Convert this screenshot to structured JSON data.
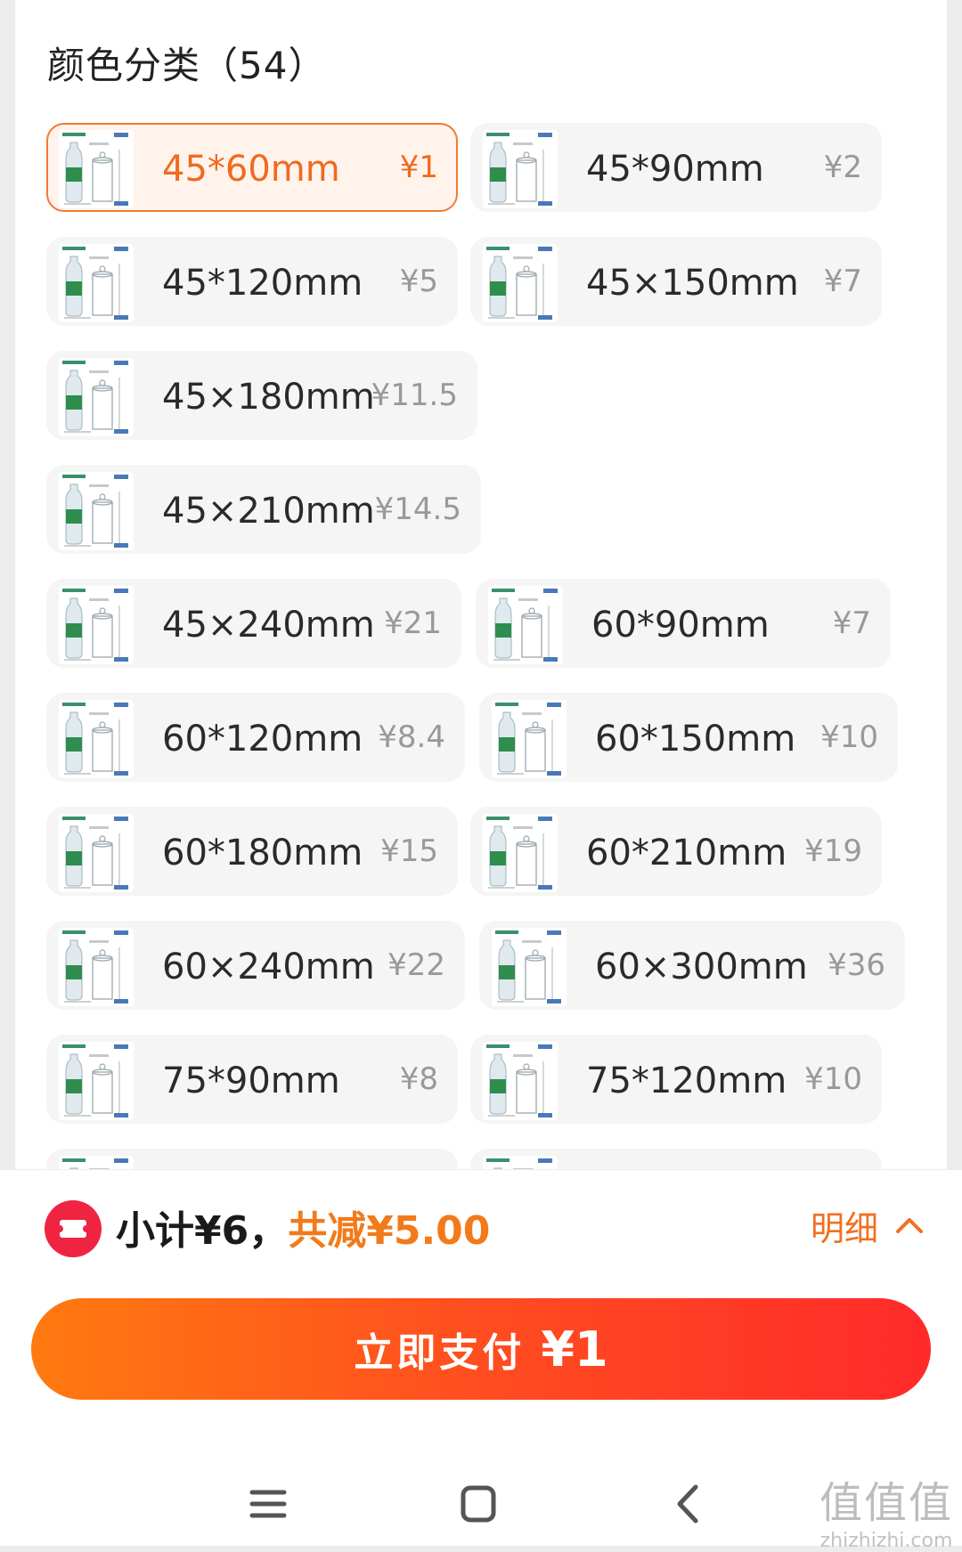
{
  "section": {
    "title": "颜色分类（54）"
  },
  "options": [
    {
      "name": "45*60mm",
      "price": "¥1",
      "selected": true
    },
    {
      "name": "45*90mm",
      "price": "¥2",
      "selected": false
    },
    {
      "name": "45*120mm",
      "price": "¥5",
      "selected": false
    },
    {
      "name": "45×150mm",
      "price": "¥7",
      "selected": false
    },
    {
      "name": "45×180mm",
      "price": "¥11.5",
      "selected": false
    },
    {
      "name": "45×210mm",
      "price": "¥14.5",
      "selected": false
    },
    {
      "name": "45×240mm",
      "price": "¥21",
      "selected": false
    },
    {
      "name": "60*90mm",
      "price": "¥7",
      "selected": false
    },
    {
      "name": "60*120mm",
      "price": "¥8.4",
      "selected": false
    },
    {
      "name": "60*150mm",
      "price": "¥10",
      "selected": false
    },
    {
      "name": "60*180mm",
      "price": "¥15",
      "selected": false
    },
    {
      "name": "60*210mm",
      "price": "¥19",
      "selected": false
    },
    {
      "name": "60×240mm",
      "price": "¥22",
      "selected": false
    },
    {
      "name": "60×300mm",
      "price": "¥36",
      "selected": false
    },
    {
      "name": "75*90mm",
      "price": "¥8",
      "selected": false
    },
    {
      "name": "75*120mm",
      "price": "¥10",
      "selected": false
    },
    {
      "name": "",
      "price": "",
      "selected": false
    },
    {
      "name": "",
      "price": "",
      "selected": false
    }
  ],
  "summary": {
    "subtotal": "小计¥6，",
    "discount": "共减¥5.00",
    "detail_label": "明细"
  },
  "pay": {
    "label": "立即支付",
    "amount": "¥1"
  },
  "navigation": {
    "icons": [
      "menu-icon",
      "home-icon",
      "back-icon"
    ]
  },
  "watermark": {
    "mark": "值值值",
    "url": "zhizhizhi.com"
  },
  "colors": {
    "accent": "#f06a1e",
    "pay_gradient_start": "#ff7a10",
    "pay_gradient_end": "#ff2a2a",
    "coupon": "#ef2441"
  }
}
